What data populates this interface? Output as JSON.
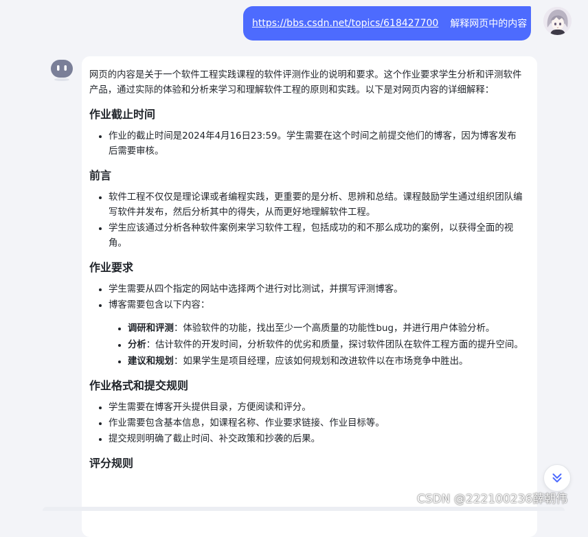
{
  "user_message": {
    "link": "https://bbs.csdn.net/topics/618427700",
    "text": "解释网页中的内容"
  },
  "answer": {
    "intro": "网页的内容是关于一个软件工程实践课程的软件评测作业的说明和要求。这个作业要求学生分析和评测软件产品，通过实际的体验和分析来学习和理解软件工程的原则和实践。以下是对网页内容的详细解释：",
    "sections": [
      {
        "heading": "作业截止时间",
        "items": [
          "作业的截止时间是2024年4月16日23:59。学生需要在这个时间之前提交他们的博客，因为博客发布后需要审核。"
        ]
      },
      {
        "heading": "前言",
        "items": [
          "软件工程不仅仅是理论课或者编程实践，更重要的是分析、思辨和总结。课程鼓励学生通过组织团队编写软件并发布，然后分析其中的得失，从而更好地理解软件工程。",
          "学生应该通过分析各种软件案例来学习软件工程，包括成功的和不那么成功的案例，以获得全面的视角。"
        ]
      },
      {
        "heading": "作业要求",
        "items": [
          "学生需要从四个指定的网站中选择两个进行对比测试，并撰写评测博客。",
          "博客需要包含以下内容："
        ],
        "subitems": [
          {
            "term": "调研和评测",
            "sep": "：",
            "text": "体验软件的功能，找出至少一个高质量的功能性bug，并进行用户体验分析。"
          },
          {
            "term": "分析",
            "sep": "：",
            "text": "估计软件的开发时间，分析软件的优劣和质量，探讨软件团队在软件工程方面的提升空间。"
          },
          {
            "term": "建议和规划",
            "sep": "：",
            "text": "如果学生是项目经理，应该如何规划和改进软件以在市场竞争中胜出。"
          }
        ]
      },
      {
        "heading": "作业格式和提交规则",
        "items": [
          "学生需要在博客开头提供目录，方便阅读和评分。",
          "作业需要包含基本信息，如课程名称、作业要求链接、作业目标等。",
          "提交规则明确了截止时间、补交政策和抄袭的后果。"
        ]
      },
      {
        "heading": "评分规则",
        "items": []
      }
    ]
  },
  "watermark": "CSDN @222100236薛朝伟",
  "icons": {
    "bot_avatar": "robot-face-icon",
    "user_avatar": "anime-avatar-icon",
    "scroll_down": "double-chevron-down-icon"
  },
  "colors": {
    "accent": "#4d6bfe",
    "status_dot": "#5eead4",
    "background": "#f3f4f8"
  }
}
